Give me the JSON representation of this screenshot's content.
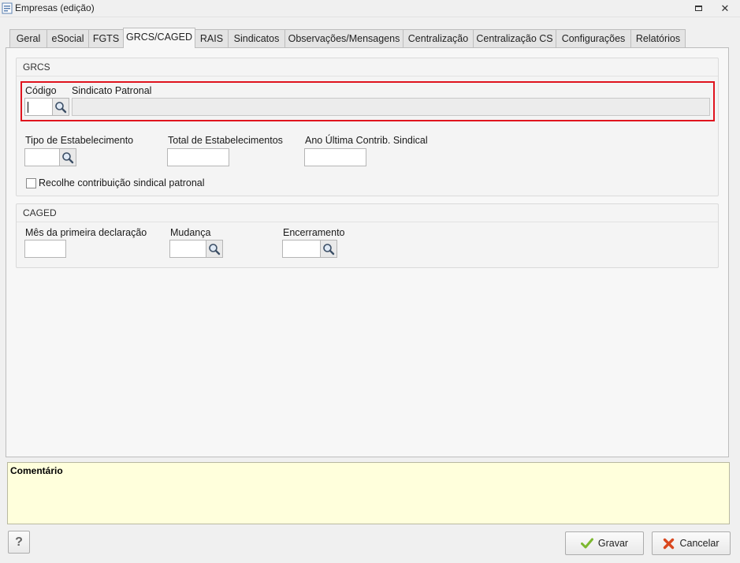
{
  "window": {
    "title": "Empresas (edição)",
    "restore_icon": "restore-icon",
    "close_glyph": "✕"
  },
  "tabs": [
    {
      "label": "Geral"
    },
    {
      "label": "eSocial"
    },
    {
      "label": "FGTS"
    },
    {
      "label": "GRCS/CAGED",
      "active": true
    },
    {
      "label": "RAIS"
    },
    {
      "label": "Sindicatos"
    },
    {
      "label": "Observações/Mensagens"
    },
    {
      "label": "Centralização"
    },
    {
      "label": "Centralização CS"
    },
    {
      "label": "Configurações"
    },
    {
      "label": "Relatórios"
    }
  ],
  "grcs": {
    "title": "GRCS",
    "codigo_label": "Código",
    "codigo_value": "",
    "sindicato_label": "Sindicato Patronal",
    "sindicato_value": "",
    "tipo_label": "Tipo de Estabelecimento",
    "tipo_value": "",
    "total_label": "Total de Estabelecimentos",
    "total_value": "",
    "ano_label": "Ano Última Contrib. Sindical",
    "ano_value": "",
    "recolhe_label": "Recolhe contribuição sindical patronal",
    "recolhe_checked": false
  },
  "caged": {
    "title": "CAGED",
    "mes_label": "Mês da primeira declaração",
    "mes_value": "",
    "mudanca_label": "Mudança",
    "mudanca_value": "",
    "encerramento_label": "Encerramento",
    "encerramento_value": ""
  },
  "comment": {
    "label": "Comentário",
    "value": ""
  },
  "footer": {
    "help_label": "?",
    "save_label": "Gravar",
    "cancel_label": "Cancelar"
  },
  "colors": {
    "highlight": "#e0141e",
    "comment_bg": "#ffffdc",
    "save_check": "#7cb82f",
    "cancel_x": "#d9481f"
  }
}
